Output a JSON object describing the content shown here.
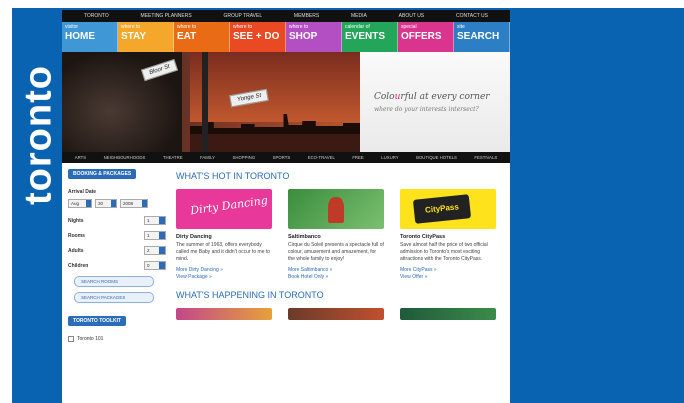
{
  "brand": {
    "logo_text": "toronto"
  },
  "colors": {
    "background": "#0a63b0",
    "accent": "#2a6cb8"
  },
  "top_nav": [
    "toronto",
    "meeting planners",
    "group travel",
    "members",
    "media",
    "about us",
    "contact us"
  ],
  "main_nav": [
    {
      "small": "visitor",
      "big": "home",
      "color": "#3f97d6"
    },
    {
      "small": "where to",
      "big": "stay",
      "color": "#f4a72a"
    },
    {
      "small": "where to",
      "big": "eat",
      "color": "#ea6b16"
    },
    {
      "small": "where to",
      "big": "see + do",
      "color": "#e94a23"
    },
    {
      "small": "where to",
      "big": "shop",
      "color": "#b34fc2"
    },
    {
      "small": "calendar of",
      "big": "events",
      "color": "#23a55a"
    },
    {
      "small": "special",
      "big": "offers",
      "color": "#d9348e"
    },
    {
      "small": "site",
      "big": "search",
      "color": "#2d7fc5"
    }
  ],
  "hero": {
    "sign1": "Bloor St",
    "sign2": "Yonge St",
    "tagline_prefix": "Colo",
    "tagline_accent": "u",
    "tagline_suffix": "rful at every corner",
    "subline": "where do your interests intersect?"
  },
  "interest_nav": [
    "arts",
    "neighbourhoods",
    "theatre",
    "family",
    "shopping",
    "sports",
    "eco-travel",
    "free",
    "luxury",
    "boutique hotels",
    "festivals"
  ],
  "sidebar": {
    "book_button": "booking & packages",
    "arrival_label": "Arrival Date",
    "date_month": "Aug",
    "date_day": "30",
    "date_year": "2008",
    "rows": [
      {
        "label": "Nights",
        "value": "1"
      },
      {
        "label": "Rooms",
        "value": "1"
      },
      {
        "label": "Adults",
        "value": "2"
      },
      {
        "label": "Children",
        "value": "0"
      }
    ],
    "search_rooms": "search rooms",
    "search_packages": "search packages",
    "toolkit_button": "toronto toolkit",
    "toolkit_item": "Toronto 101"
  },
  "hot": {
    "title": "What's hot in Toronto",
    "cards": [
      {
        "img_text": "Dirty Dancing",
        "title": "Dirty Dancing",
        "desc": "The summer of 1963, offers everybody called me Baby and it didn't occur to me to mind.",
        "links": [
          "More Dirty Dancing »",
          "View Package »"
        ]
      },
      {
        "img_text": "",
        "title": "Saltimbanco",
        "desc": "Cirque du Soleil presents a spectacle full of colour, amusement and amazement, for the whole family to enjoy!",
        "links": [
          "More Saltimbanco »",
          "Book Hotel Only »"
        ]
      },
      {
        "img_text": "CityPass",
        "title": "Toronto CityPass",
        "desc": "Save almost half the price of two official admission to Toronto's most exciting attractions with the Toronto CityPass.",
        "links": [
          "More CityPass »",
          "View Offer »"
        ]
      }
    ]
  },
  "happening": {
    "title": "What's happening in Toronto"
  }
}
